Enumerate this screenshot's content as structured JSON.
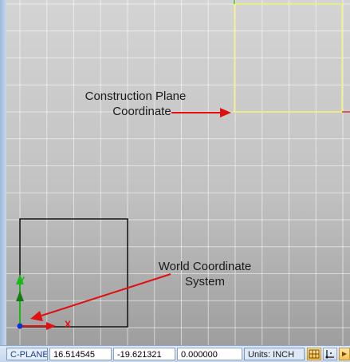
{
  "viewport": {
    "callouts": {
      "construction_plane": {
        "line1": "Construction Plane",
        "line2": "Coordinate"
      },
      "world_coordinate": {
        "line1": "World Coordinate",
        "line2": "System"
      }
    },
    "axis_labels": {
      "x": "X",
      "y": "Y"
    },
    "colors": {
      "construction_plane_square": "#f2f27a",
      "arrow": "#e01010",
      "x_axis": "#e01010",
      "y_axis": "#18b818",
      "world_square": "#111111",
      "grid": "#ffffff"
    }
  },
  "statusbar": {
    "mode": "C-PLANE",
    "x_value": "16.514545",
    "y_value": "-19.621321",
    "z_value": "0.000000",
    "units": "Units: INCH",
    "icons": [
      "grid-snap-icon",
      "ortho-icon",
      "snap-menu-icon"
    ]
  }
}
